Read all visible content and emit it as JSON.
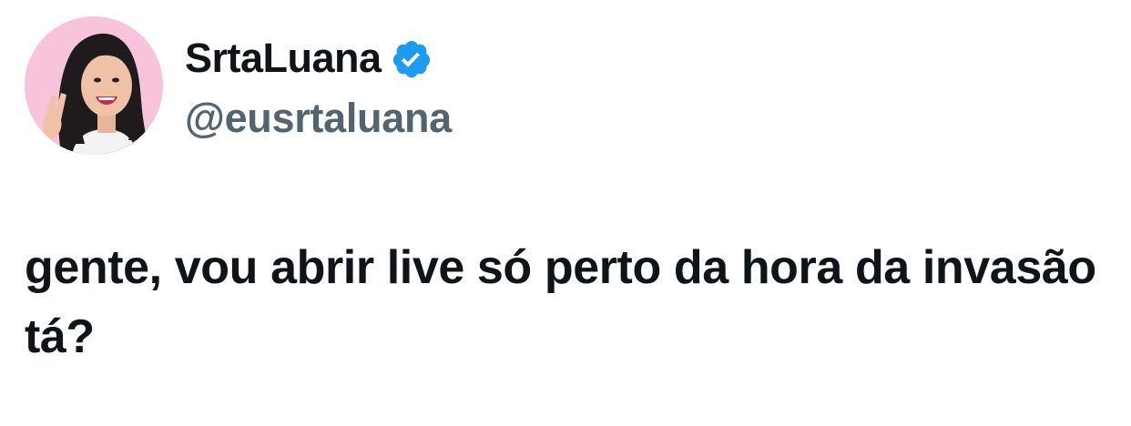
{
  "tweet": {
    "author": {
      "display_name": "SrtaLuana",
      "handle": "@eusrtaluana",
      "verified": true,
      "avatar_icon": "profile-photo"
    },
    "text": "gente, vou abrir live só perto da hora da invasão tá?"
  },
  "colors": {
    "background": "#ffffff",
    "text_primary": "#0f1419",
    "text_secondary": "#536471",
    "verified_badge": "#1d9bf0",
    "avatar_background": "#f7c4dc"
  }
}
